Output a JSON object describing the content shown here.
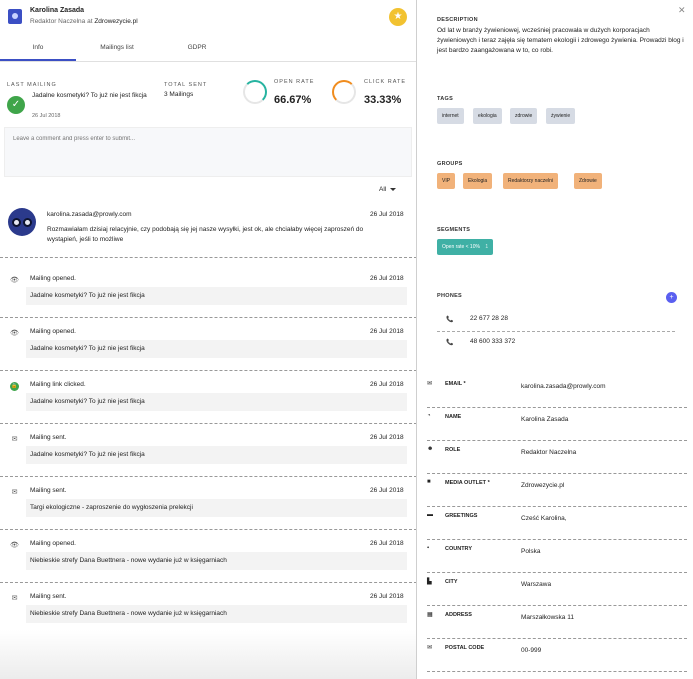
{
  "header": {
    "name": "Karolina Zasada",
    "role": "Redaktor Naczelna",
    "at": "at",
    "outlet": "Zdrowezycie.pl"
  },
  "tabs": [
    "Info",
    "Mailings list",
    "GDPR"
  ],
  "stats": {
    "last_mailing_label": "LAST MAILING",
    "last_mailing_title": "Jadalne kosmetyki? To już nie jest fikcja",
    "last_mailing_date": "26 Jul 2018",
    "total_sent_label": "TOTAL SENT",
    "total_sent_value": "3 Mailings",
    "open_rate_label": "OPEN RATE",
    "open_rate_value": "66.67%",
    "open_rate_fraction": 0.6667,
    "click_rate_label": "CLICK RATE",
    "click_rate_value": "33.33%",
    "click_rate_fraction": 0.3333
  },
  "comment": {
    "placeholder": "Leave a comment and press enter to submit..."
  },
  "filter": {
    "selected": "All"
  },
  "note": {
    "email": "karolina.zasada@prowly.com",
    "date": "26 Jul 2018",
    "text": "Rozmawiałam dzisiaj relacyjnie, czy podobają się jej nasze wysyłki, jest ok, ale chciałaby więcej zaproszeń do wystąpień, jeśli to możliwe"
  },
  "events": [
    {
      "icon": "eye-icon",
      "glyph": "👁",
      "title": "Mailing opened.",
      "date": "26 Jul 2018",
      "subject": "Jadalne kosmetyki? To już nie jest fikcja"
    },
    {
      "icon": "eye-icon",
      "glyph": "👁",
      "title": "Mailing opened.",
      "date": "26 Jul 2018",
      "subject": "Jadalne kosmetyki? To już nie jest fikcja"
    },
    {
      "icon": "lock-icon",
      "glyph": "🔒",
      "title": "Mailing link clicked.",
      "date": "26 Jul 2018",
      "subject": "Jadalne kosmetyki? To już nie jest fikcja"
    },
    {
      "icon": "mail-icon",
      "glyph": "✉",
      "title": "Mailing sent.",
      "date": "26 Jul 2018",
      "subject": "Jadalne kosmetyki? To już nie jest fikcja"
    },
    {
      "icon": "mail-icon",
      "glyph": "✉",
      "title": "Mailing sent.",
      "date": "26 Jul 2018",
      "subject": "Targi ekologiczne - zaproszenie do wygłoszenia prelekcji"
    },
    {
      "icon": "eye-icon",
      "glyph": "👁",
      "title": "Mailing opened.",
      "date": "26 Jul 2018",
      "subject": "Niebieskie strefy Dana Buettnera - nowe wydanie już w księgarniach"
    },
    {
      "icon": "mail-icon",
      "glyph": "✉",
      "title": "Mailing sent.",
      "date": "26 Jul 2018",
      "subject": "Niebieskie strefy Dana Buettnera - nowe wydanie już w księgarniach"
    }
  ],
  "right": {
    "description_label": "DESCRIPTION",
    "description": "Od lat w branży żywieniowej, wcześniej pracowała w dużych korporacjach żywieniowych i teraz zajęła się tematem ekologii i zdrowego żywienia. Prowadzi blog i jest bardzo zaangażowana w to, co robi.",
    "tags_label": "TAGS",
    "tags": [
      "internet",
      "ekologia",
      "zdrowie",
      "żywienie"
    ],
    "groups_label": "GROUPS",
    "groups": [
      "VIP",
      "Ekologia",
      "Redaktorzy naczelni",
      "Zdrowie"
    ],
    "segments_label": "SEGMENTS",
    "segment": "Open rate < 10%",
    "segment_count": "1",
    "phones_label": "PHONES",
    "phones": [
      "22 677 28 28",
      "48 600 333 372"
    ],
    "fields": [
      {
        "icon": "mail-icon",
        "glyph": "✉",
        "label": "EMAIL *",
        "value": "karolina.zasada@prowly.com"
      },
      {
        "icon": "person-icon",
        "glyph": "◔",
        "label": "NAME",
        "value": "Karolina Zasada"
      },
      {
        "icon": "badge-icon",
        "glyph": "☻",
        "label": "ROLE",
        "value": "Redaktor Naczelna"
      },
      {
        "icon": "briefcase-icon",
        "glyph": "■",
        "label": "MEDIA OUTLET *",
        "value": "Zdrowezycie.pl"
      },
      {
        "icon": "chat-icon",
        "glyph": "▬",
        "label": "GREETINGS",
        "value": "Cześć Karolina,"
      },
      {
        "icon": "pin-icon",
        "glyph": "⬩",
        "label": "COUNTRY",
        "value": "Polska"
      },
      {
        "icon": "city-icon",
        "glyph": "▙",
        "label": "CITY",
        "value": "Warszawa"
      },
      {
        "icon": "building-icon",
        "glyph": "▦",
        "label": "ADDRESS",
        "value": "Marszałkowska 11"
      },
      {
        "icon": "mail-icon",
        "glyph": "✉",
        "label": "POSTAL CODE",
        "value": "00-999"
      }
    ]
  }
}
